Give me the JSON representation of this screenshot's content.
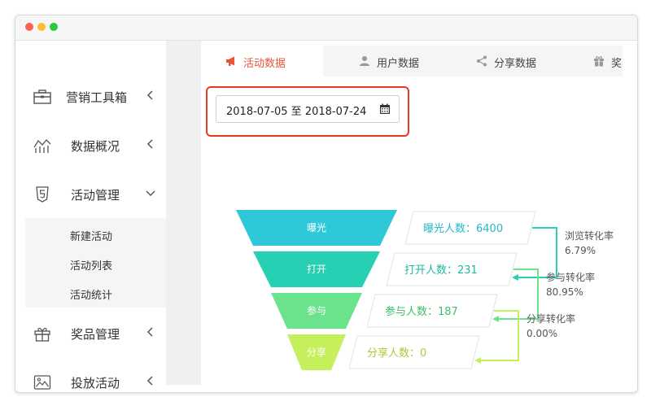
{
  "sidebar": {
    "items": [
      {
        "label": "营销工具箱",
        "icon": "toolbox-icon",
        "arrow": "left"
      },
      {
        "label": "数据概况",
        "icon": "chart-line-icon",
        "arrow": "left"
      },
      {
        "label": "活动管理",
        "icon": "html5-icon",
        "arrow": "down"
      },
      {
        "label": "奖品管理",
        "icon": "gift-icon",
        "arrow": "left"
      },
      {
        "label": "投放活动",
        "icon": "image-icon",
        "arrow": "left"
      }
    ],
    "subitems": [
      {
        "label": "新建活动"
      },
      {
        "label": "活动列表"
      },
      {
        "label": "活动统计"
      }
    ]
  },
  "tabs": [
    {
      "label": "活动数据",
      "icon": "megaphone-icon",
      "active": true
    },
    {
      "label": "用户数据",
      "icon": "user-icon",
      "active": false
    },
    {
      "label": "分享数据",
      "icon": "share-icon",
      "active": false
    },
    {
      "label": "奖品数据",
      "icon": "gift-icon",
      "active": false
    }
  ],
  "date_range": {
    "value": "2018-07-05 至 2018-07-24"
  },
  "funnel": {
    "stages": [
      {
        "name": "曝光",
        "card": "曝光人数：6400",
        "count": 6400,
        "color": "#2ec8d8",
        "text_color": "#26b7c6"
      },
      {
        "name": "打开",
        "card": "打开人数：231",
        "count": 231,
        "color": "#27d0b2",
        "text_color": "#1fb99e"
      },
      {
        "name": "参与",
        "card": "参与人数：187",
        "count": 187,
        "color": "#6be28c",
        "text_color": "#3fbf6a"
      },
      {
        "name": "分享",
        "card": "分享人数：0",
        "count": 0,
        "color": "#c6ef5c",
        "text_color": "#a5cf33"
      }
    ],
    "rates": [
      {
        "label": "浏览转化率",
        "value": "6.79%"
      },
      {
        "label": "参与转化率",
        "value": "80.95%"
      },
      {
        "label": "分享转化率",
        "value": "0.00%"
      }
    ]
  },
  "colors": {
    "accent": "#e8543a",
    "highlight_border": "#e53a20"
  }
}
